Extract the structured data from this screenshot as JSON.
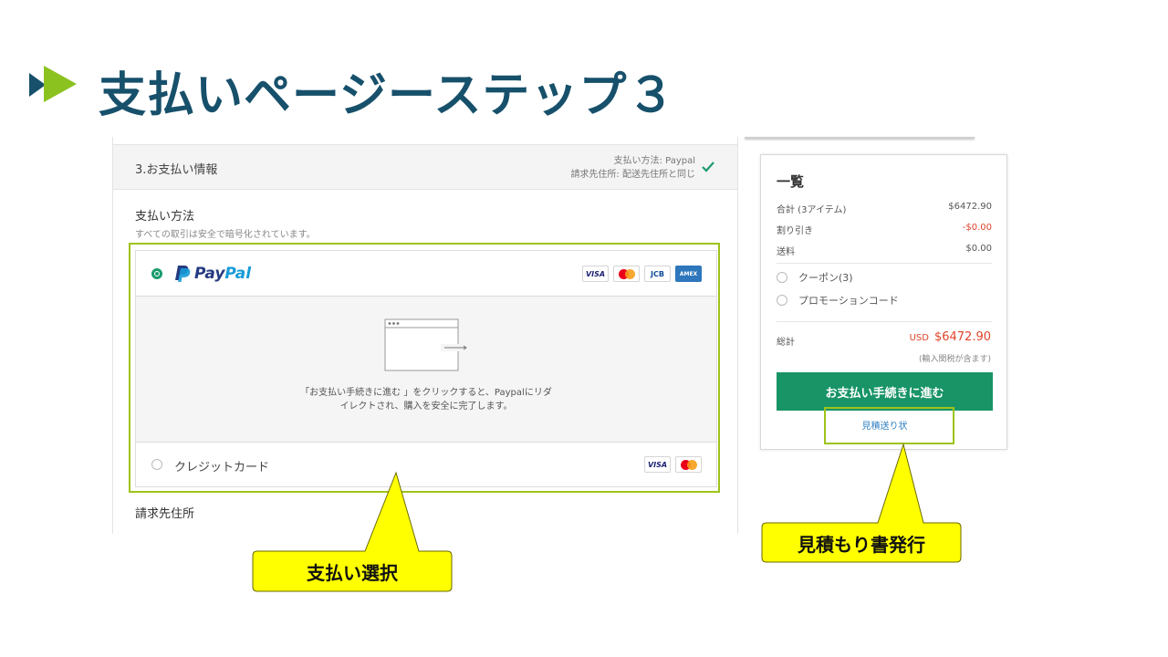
{
  "slide": {
    "title": "支払いページーステップ３"
  },
  "checkout": {
    "section_title": "3.お支払い情報",
    "summary_line1": "支払い方法:  Paypal",
    "summary_line2": "請求先住所:  配送先住所と同じ",
    "payment_method_title": "支払い方法",
    "payment_method_sub": "すべての取引は安全で暗号化されています。",
    "paypal": {
      "brand_pay": "Pay",
      "brand_pal": "Pal",
      "cards": [
        "VISA",
        "JCB",
        "AMEX"
      ],
      "redirect_line1": "「お支払い手続きに進む 」をクリックすると、Paypalにリダ",
      "redirect_line2": "イレクトされ、購入を安全に完了します。"
    },
    "credit_card_label": "クレジットカード",
    "credit_cards": [
      "VISA"
    ],
    "billing_title": "請求先住所"
  },
  "summary": {
    "title": "一覧",
    "subtotal_label": "合計 (3アイテム)",
    "subtotal_value": "$6472.90",
    "discount_label": "割り引き",
    "discount_value": "-$0.00",
    "shipping_label": "送料",
    "shipping_value": "$0.00",
    "coupon_label": "クーポン(3)",
    "promo_label": "プロモーションコード",
    "total_label": "総計",
    "total_currency": "USD",
    "total_value": "$6472.90",
    "tax_note": "(輸入関税が含ます)",
    "checkout_button": "お支払い手続きに進む",
    "quote_link": "見積送り状"
  },
  "callouts": {
    "payment_select": "支払い選択",
    "quote_issue": "見積もり書発行"
  },
  "colors": {
    "title": "#17506b",
    "accent_green": "#189467",
    "highlight": "#9ec31a",
    "callout_fill": "#ffff00",
    "price_red": "#e0452b"
  }
}
